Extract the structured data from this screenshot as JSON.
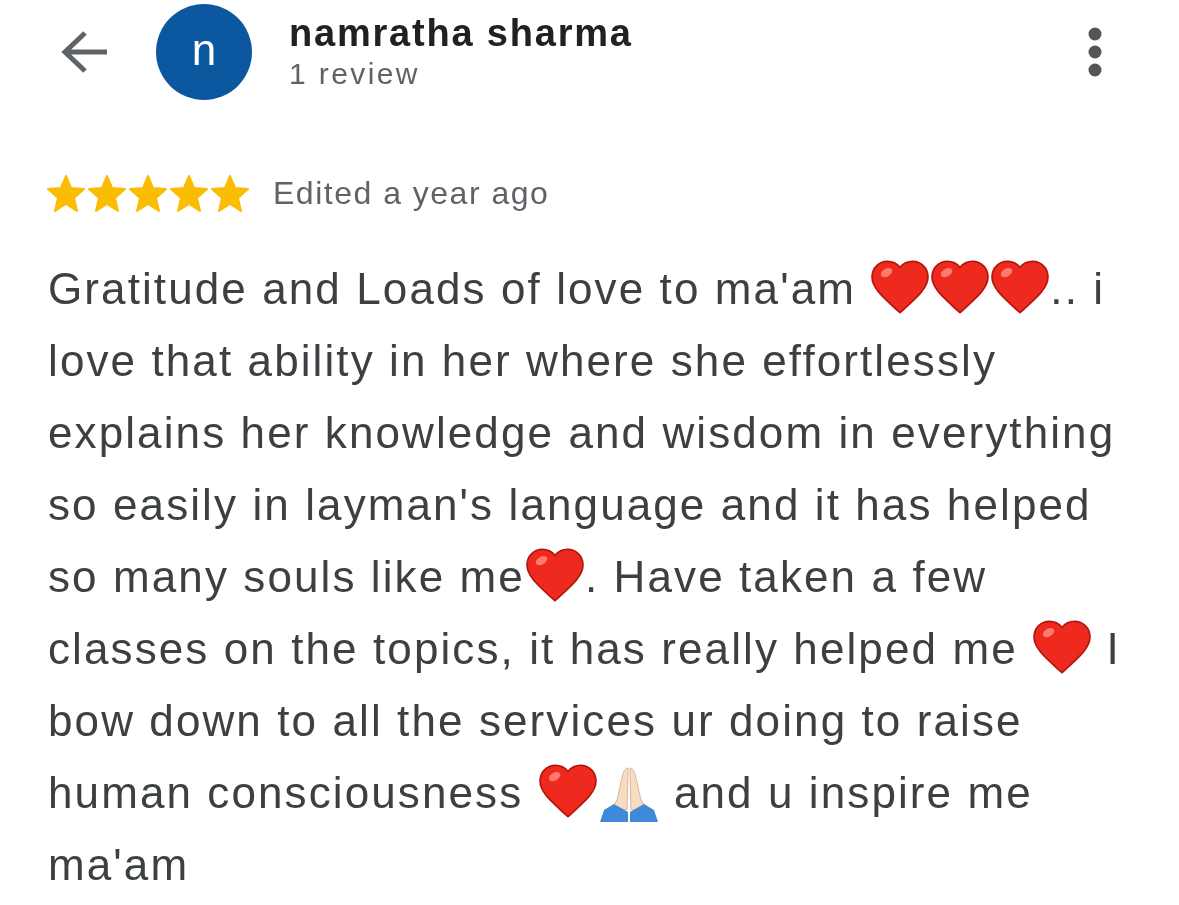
{
  "reviewer": {
    "avatar_initial": "n",
    "name": "namratha sharma",
    "review_count": "1 review"
  },
  "review": {
    "stars": 5,
    "date": "Edited a year ago",
    "lines": [
      [
        {
          "kind": "text",
          "text": "Gratitude and Loads of love to ma'am "
        },
        {
          "kind": "heart"
        },
        {
          "kind": "heart"
        },
        {
          "kind": "heart"
        },
        {
          "kind": "text",
          "text": ".. i"
        }
      ],
      [
        {
          "kind": "text",
          "text": "love that ability in her where she effortlessly"
        }
      ],
      [
        {
          "kind": "text",
          "text": "explains her knowledge and wisdom in everything"
        }
      ],
      [
        {
          "kind": "text",
          "text": "so easily in layman's language and it has helped"
        }
      ],
      [
        {
          "kind": "text",
          "text": "so many souls like me"
        },
        {
          "kind": "heart"
        },
        {
          "kind": "text",
          "text": ". Have taken a few"
        }
      ],
      [
        {
          "kind": "text",
          "text": "classes on the topics, it has really helped me "
        },
        {
          "kind": "heart"
        },
        {
          "kind": "text",
          "text": " I"
        }
      ],
      [
        {
          "kind": "text",
          "text": "bow down to all the services ur doing to raise"
        }
      ],
      [
        {
          "kind": "text",
          "text": "human consciousness "
        },
        {
          "kind": "heart"
        },
        {
          "kind": "hands"
        },
        {
          "kind": "text",
          "text": " and u inspire me"
        }
      ],
      [
        {
          "kind": "text",
          "text": "ma'am"
        }
      ]
    ]
  }
}
